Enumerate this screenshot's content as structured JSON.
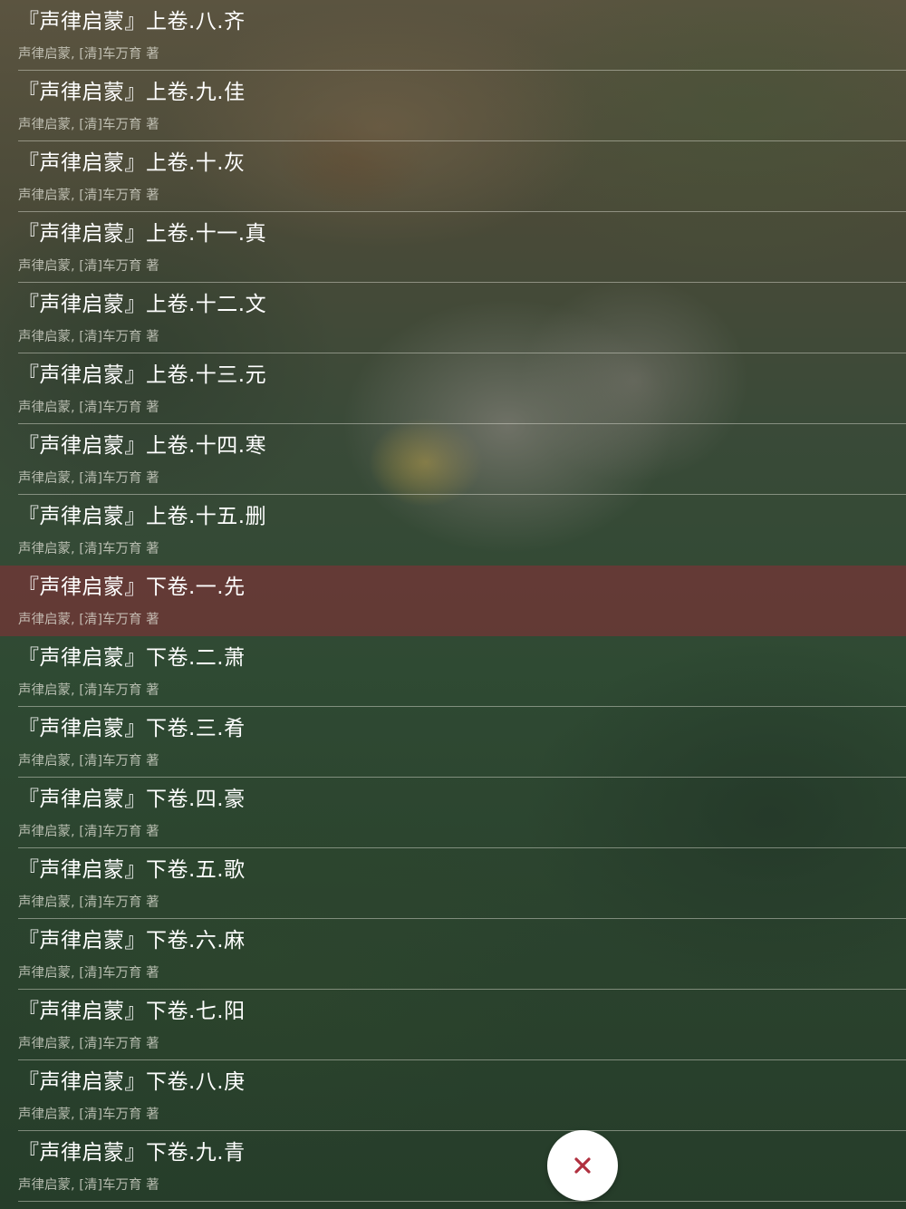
{
  "items": [
    {
      "title": "『声律启蒙』上卷.八.齐",
      "subtitle": "声律启蒙, [清]车万育 著",
      "selected": false
    },
    {
      "title": "『声律启蒙』上卷.九.佳",
      "subtitle": "声律启蒙, [清]车万育 著",
      "selected": false
    },
    {
      "title": "『声律启蒙』上卷.十.灰",
      "subtitle": "声律启蒙, [清]车万育 著",
      "selected": false
    },
    {
      "title": "『声律启蒙』上卷.十一.真",
      "subtitle": "声律启蒙, [清]车万育 著",
      "selected": false
    },
    {
      "title": "『声律启蒙』上卷.十二.文",
      "subtitle": "声律启蒙, [清]车万育 著",
      "selected": false
    },
    {
      "title": "『声律启蒙』上卷.十三.元",
      "subtitle": "声律启蒙, [清]车万育 著",
      "selected": false
    },
    {
      "title": "『声律启蒙』上卷.十四.寒",
      "subtitle": "声律启蒙, [清]车万育 著",
      "selected": false
    },
    {
      "title": "『声律启蒙』上卷.十五.删",
      "subtitle": "声律启蒙, [清]车万育 著",
      "selected": false
    },
    {
      "title": "『声律启蒙』下卷.一.先",
      "subtitle": "声律启蒙, [清]车万育 著",
      "selected": true
    },
    {
      "title": "『声律启蒙』下卷.二.萧",
      "subtitle": "声律启蒙, [清]车万育 著",
      "selected": false
    },
    {
      "title": "『声律启蒙』下卷.三.肴",
      "subtitle": "声律启蒙, [清]车万育 著",
      "selected": false
    },
    {
      "title": "『声律启蒙』下卷.四.豪",
      "subtitle": "声律启蒙, [清]车万育 著",
      "selected": false
    },
    {
      "title": "『声律启蒙』下卷.五.歌",
      "subtitle": "声律启蒙, [清]车万育 著",
      "selected": false
    },
    {
      "title": "『声律启蒙』下卷.六.麻",
      "subtitle": "声律启蒙, [清]车万育 著",
      "selected": false
    },
    {
      "title": "『声律启蒙』下卷.七.阳",
      "subtitle": "声律启蒙, [清]车万育 著",
      "selected": false
    },
    {
      "title": "『声律启蒙』下卷.八.庚",
      "subtitle": "声律启蒙, [清]车万育 著",
      "selected": false
    },
    {
      "title": "『声律启蒙』下卷.九.青",
      "subtitle": "声律启蒙, [清]车万育 著",
      "selected": false
    }
  ],
  "close_button": {
    "icon": "close-icon",
    "color": "#b0303f"
  },
  "colors": {
    "selected_row": "#8c2d37",
    "title_text": "#ffffff",
    "subtitle_text": "#e1e1d7"
  }
}
